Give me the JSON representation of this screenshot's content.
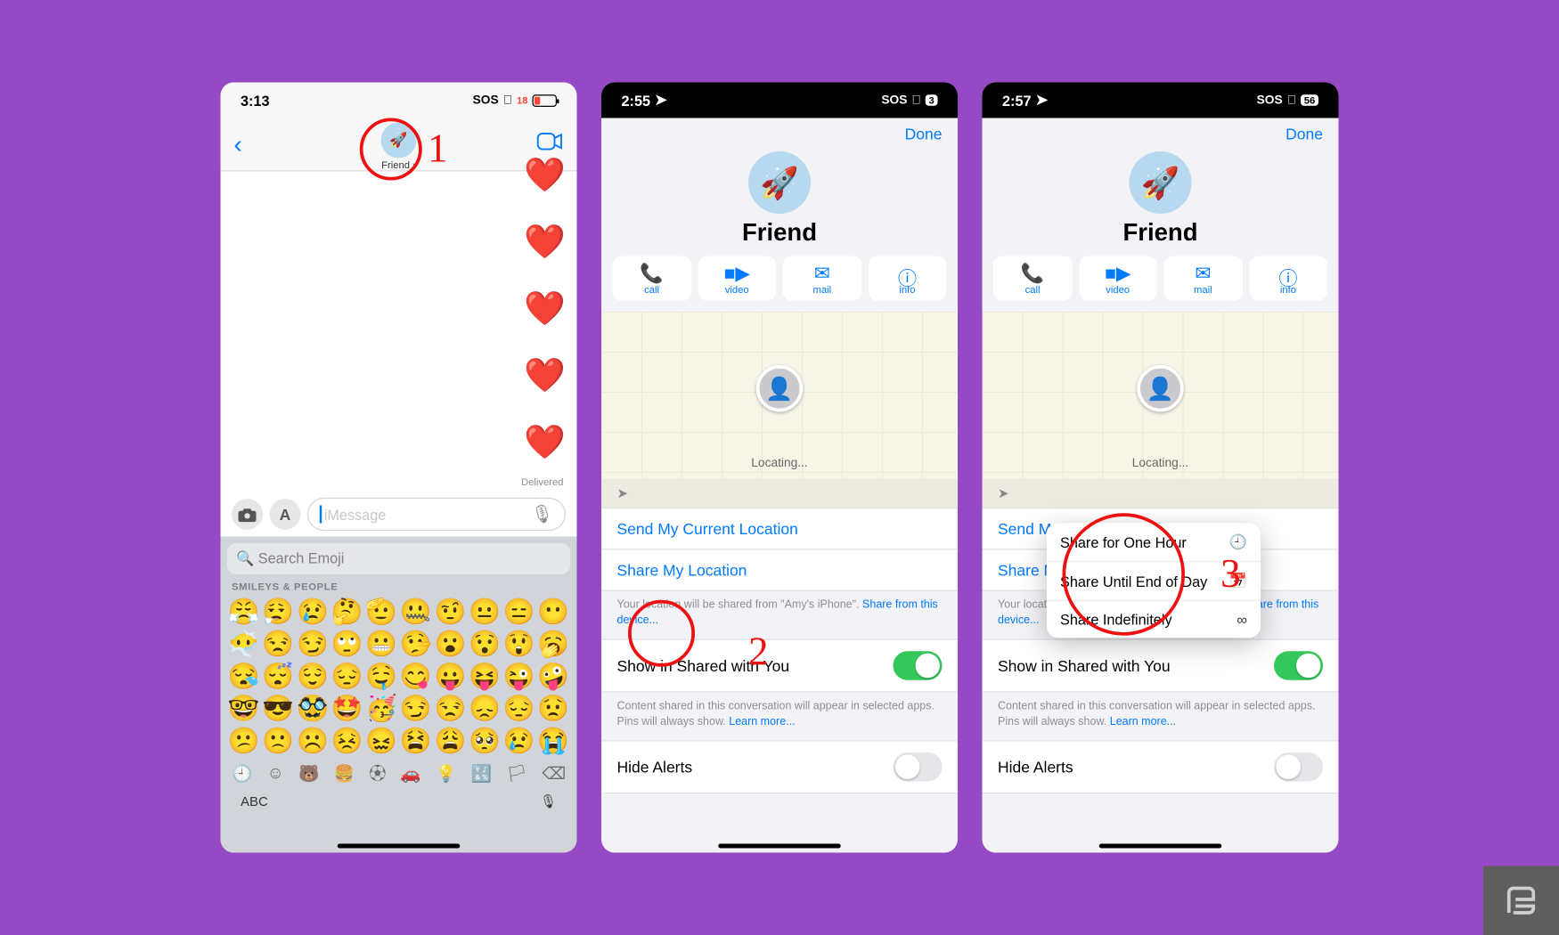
{
  "annotations": {
    "n1": "1",
    "n2": "2",
    "n3": "3"
  },
  "phone1": {
    "time": "3:13",
    "status_sos": "SOS",
    "batt": "18",
    "contact_name": "Friend",
    "delivered": "Delivered",
    "message_placeholder": "iMessage",
    "kb_search": "Search Emoji",
    "kb_category": "SMILEYS & PEOPLE",
    "abc": "ABC",
    "emojis": [
      "😤",
      "😮‍💨",
      "😢",
      "🤔",
      "🫡",
      "🤐",
      "🤨",
      "😐",
      "😑",
      "😶",
      "😶‍🌫️",
      "😒",
      "😏",
      "🙄",
      "😬",
      "🤥",
      "😮",
      "😯",
      "😲",
      "🥱",
      "😪",
      "😴",
      "😌",
      "😔",
      "🤤",
      "😋",
      "😛",
      "😝",
      "😜",
      "🤪",
      "🤓",
      "😎",
      "🥸",
      "🤩",
      "🥳",
      "😏",
      "😒",
      "😞",
      "😔",
      "😟",
      "😕",
      "🙁",
      "☹️",
      "😣",
      "😖",
      "😫",
      "😩",
      "🥺",
      "😢",
      "😭"
    ]
  },
  "phone2": {
    "time": "2:55",
    "status_sos": "SOS",
    "batt": "3",
    "done": "Done",
    "contact_name": "Friend",
    "actions": {
      "call": "call",
      "video": "video",
      "mail": "mail",
      "info": "info"
    },
    "locating": "Locating...",
    "send_current": "Send My Current Location",
    "share_my_loc": "Share My Location",
    "footnote_a": "Your location will be shared from \"Amy's iPhone\". ",
    "footnote_link": "Share from this device...",
    "show_shared": "Show in Shared with You",
    "show_shared_note": "Content shared in this conversation will appear in selected apps. Pins will always show. ",
    "learn_more": "Learn more...",
    "hide_alerts": "Hide Alerts"
  },
  "phone3": {
    "time": "2:57",
    "status_sos": "SOS",
    "batt": "56",
    "done": "Done",
    "contact_name": "Friend",
    "actions": {
      "call": "call",
      "video": "video",
      "mail": "mail",
      "info": "info"
    },
    "locating": "Locating...",
    "send_current": "Send My Current Location",
    "share_my_loc": "Share My Location",
    "footnote_a": "Your location will be shared from \"Amy's iPhone\". ",
    "footnote_link": "Share from this device...",
    "show_shared": "Show in Shared with You",
    "show_shared_note": "Content shared in this conversation will appear in selected apps. Pins will always show. ",
    "learn_more": "Learn more...",
    "hide_alerts": "Hide Alerts",
    "menu": {
      "one_hour": "Share for One Hour",
      "eod": "Share Until End of Day",
      "indef": "Share Indefinitely"
    }
  }
}
